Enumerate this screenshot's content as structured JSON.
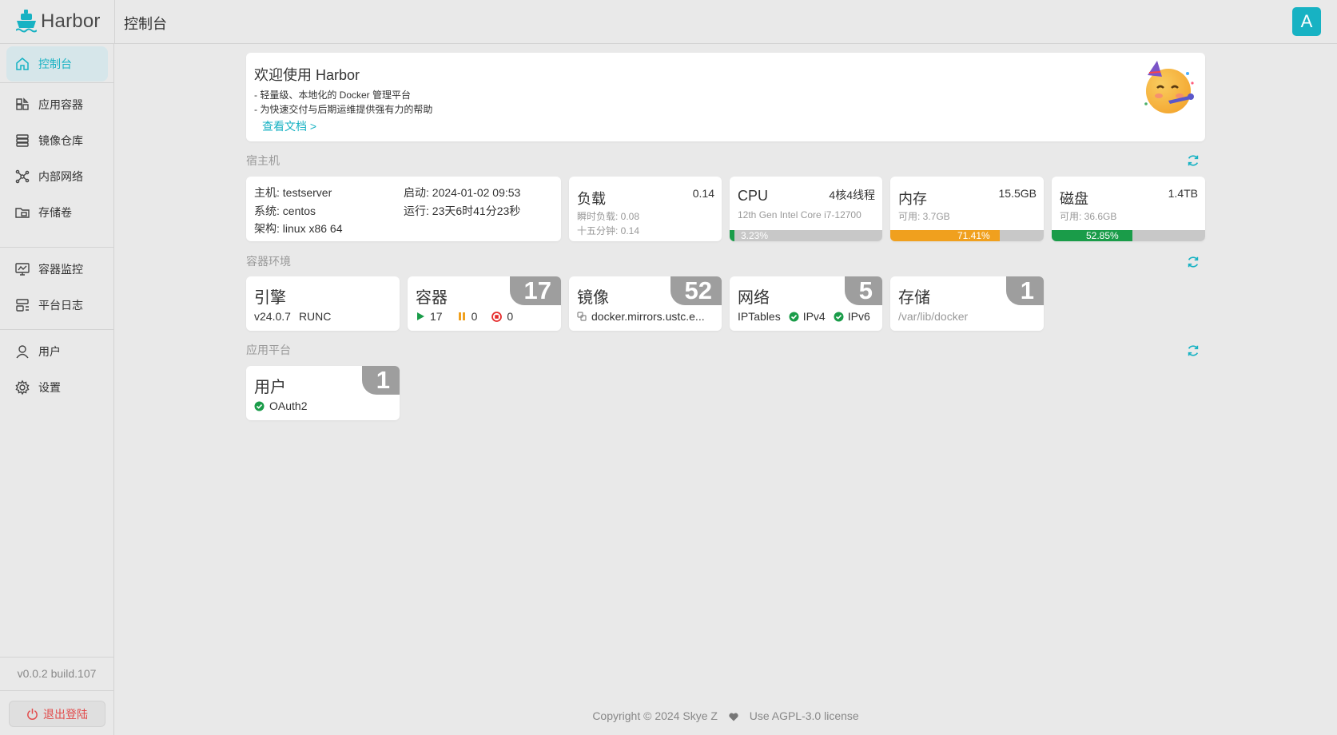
{
  "app": {
    "name": "Harbor",
    "page_title": "控制台",
    "avatar_letter": "A",
    "accent_color": "#17b2c3"
  },
  "sidebar": {
    "items": [
      {
        "label": "控制台",
        "icon": "home-icon",
        "active": true
      },
      {
        "label": "应用容器",
        "icon": "apps-icon"
      },
      {
        "label": "镜像仓库",
        "icon": "database-icon"
      },
      {
        "label": "内部网络",
        "icon": "network-icon"
      },
      {
        "label": "存储卷",
        "icon": "folder-icon"
      },
      {
        "label": "容器监控",
        "icon": "monitor-icon"
      },
      {
        "label": "平台日志",
        "icon": "log-icon"
      },
      {
        "label": "用户",
        "icon": "user-icon"
      },
      {
        "label": "设置",
        "icon": "gear-icon"
      }
    ],
    "version": "v0.0.2 build.107",
    "logout_label": "退出登陆"
  },
  "welcome": {
    "title": "欢迎使用 Harbor",
    "lines": [
      "- 轻量级、本地化的 Docker 管理平台",
      "- 为快速交付与后期运维提供强有力的帮助"
    ],
    "doc_link": "查看文档 >",
    "emoji_icon": "party-face-icon"
  },
  "host_section": {
    "label": "宿主机",
    "info": {
      "host": "主机: testserver",
      "system": "系统: centos",
      "arch": "架构: linux x86 64",
      "boot": "启动: 2024-01-02 09:53",
      "uptime": "运行: 23天6时41分23秒"
    },
    "load": {
      "title": "负载",
      "value": "0.14",
      "sub1": "瞬时负载: 0.08",
      "sub2": "十五分钟: 0.14"
    },
    "cpu": {
      "title": "CPU",
      "value": "4核4线程",
      "sub": "12th Gen Intel Core i7-12700",
      "percent_label": "3.23%",
      "percent": 3.23,
      "color": "#1a9c49"
    },
    "memory": {
      "title": "内存",
      "value": "15.5GB",
      "sub": "可用: 3.7GB",
      "percent_label": "71.41%",
      "percent": 71.41,
      "color": "#f0a01e"
    },
    "disk": {
      "title": "磁盘",
      "value": "1.4TB",
      "sub": "可用: 36.6GB",
      "percent_label": "52.85%",
      "percent": 52.85,
      "color": "#1a9c49"
    }
  },
  "env_section": {
    "label": "容器环境",
    "engine": {
      "title": "引擎",
      "version": "v24.0.7",
      "runtime": "RUNC"
    },
    "containers": {
      "title": "容器",
      "count": "17",
      "running": "17",
      "paused": "0",
      "stopped": "0"
    },
    "images": {
      "title": "镜像",
      "count": "52",
      "mirror": "docker.mirrors.ustc.e..."
    },
    "network": {
      "title": "网络",
      "count": "5",
      "driver": "IPTables",
      "ipv4": "IPv4",
      "ipv6": "IPv6"
    },
    "storage": {
      "title": "存储",
      "count": "1",
      "path": "/var/lib/docker"
    }
  },
  "platform_section": {
    "label": "应用平台",
    "users": {
      "title": "用户",
      "count": "1",
      "auth": "OAuth2"
    }
  },
  "footer": {
    "copyright": "Copyright © 2024 Skye Z",
    "license": "Use AGPL-3.0 license"
  }
}
